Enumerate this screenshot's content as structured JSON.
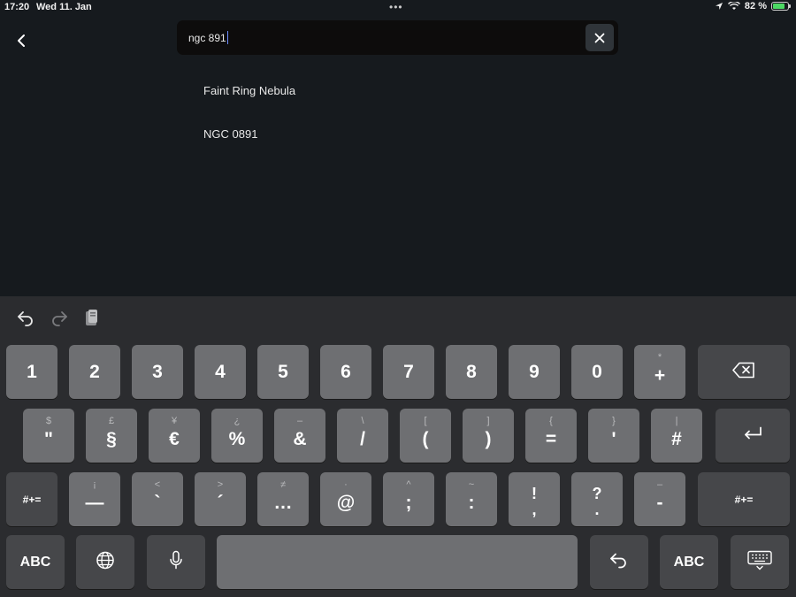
{
  "status": {
    "time": "17:20",
    "date": "Wed 11. Jan",
    "battery": "82 %",
    "battery_level": 0.82
  },
  "search": {
    "value": "ngc 891"
  },
  "results": [
    "Faint Ring Nebula",
    "NGC 0891"
  ],
  "keyboard": {
    "row1": [
      {
        "main": "1",
        "alt": ""
      },
      {
        "main": "2",
        "alt": ""
      },
      {
        "main": "3",
        "alt": ""
      },
      {
        "main": "4",
        "alt": ""
      },
      {
        "main": "5",
        "alt": ""
      },
      {
        "main": "6",
        "alt": ""
      },
      {
        "main": "7",
        "alt": ""
      },
      {
        "main": "8",
        "alt": ""
      },
      {
        "main": "9",
        "alt": ""
      },
      {
        "main": "0",
        "alt": ""
      },
      {
        "main": "+",
        "alt": "*"
      }
    ],
    "row2": [
      {
        "main": "\"",
        "alt": "$"
      },
      {
        "main": "§",
        "alt": "£"
      },
      {
        "main": "€",
        "alt": "¥"
      },
      {
        "main": "%",
        "alt": "¿"
      },
      {
        "main": "&",
        "alt": "–"
      },
      {
        "main": "/",
        "alt": "\\"
      },
      {
        "main": "(",
        "alt": "["
      },
      {
        "main": ")",
        "alt": "]"
      },
      {
        "main": "=",
        "alt": "{"
      },
      {
        "main": "'",
        "alt": "}"
      },
      {
        "main": "#",
        "alt": "|"
      }
    ],
    "row3": [
      {
        "main": "—",
        "alt": "¡"
      },
      {
        "main": "`",
        "alt": "<"
      },
      {
        "main": "´",
        "alt": ">"
      },
      {
        "main": "…",
        "alt": "≠"
      },
      {
        "main": "@",
        "alt": "·"
      },
      {
        "main": ";",
        "alt": "^"
      },
      {
        "main": ":",
        "alt": "~"
      },
      {
        "main": "!\n,",
        "alt": ""
      },
      {
        "main": "?\n.",
        "alt": ""
      },
      {
        "main": "-",
        "alt": "–"
      }
    ],
    "shift_label": "#+=",
    "abc_label": "ABC"
  }
}
